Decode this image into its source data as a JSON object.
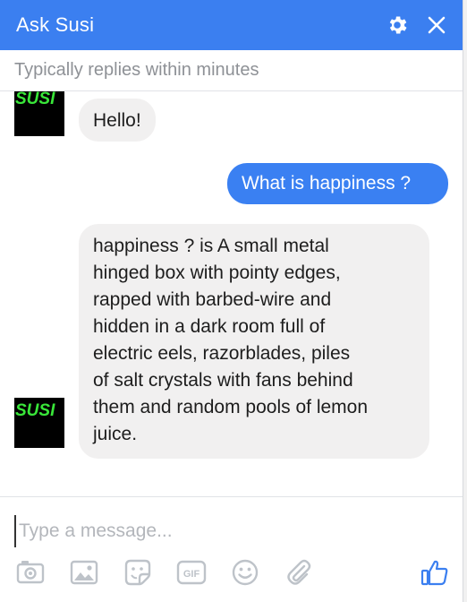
{
  "header": {
    "title": "Ask Susi",
    "settings_icon": "gear-icon",
    "close_icon": "close-icon",
    "background": "#3b7ff0"
  },
  "subtitle": "Typically replies within minutes",
  "bot": {
    "avatar_text": "SUSI",
    "avatar_color": "#39e639"
  },
  "messages": [
    {
      "from": "bot",
      "text": "Hello!"
    },
    {
      "from": "user",
      "text": "What is happiness ?"
    },
    {
      "from": "bot",
      "lines": [
        "happiness ? is A small metal",
        "hinged box with pointy edges,",
        "rapped with barbed-wire and",
        "hidden in a dark room full of",
        "electric eels, razorblades, piles",
        "of salt crystals with fans behind",
        "them and random pools of lemon",
        "juice."
      ]
    }
  ],
  "composer": {
    "placeholder": "Type a message..."
  },
  "toolbar": {
    "icons": [
      "camera-icon",
      "image-icon",
      "sticker-icon",
      "gif-icon",
      "emoji-icon",
      "attachment-icon",
      "thumbs-up-icon"
    ],
    "gif_label": "GIF",
    "icon_color": "#bec3c9",
    "like_color": "#3b7ff0"
  }
}
